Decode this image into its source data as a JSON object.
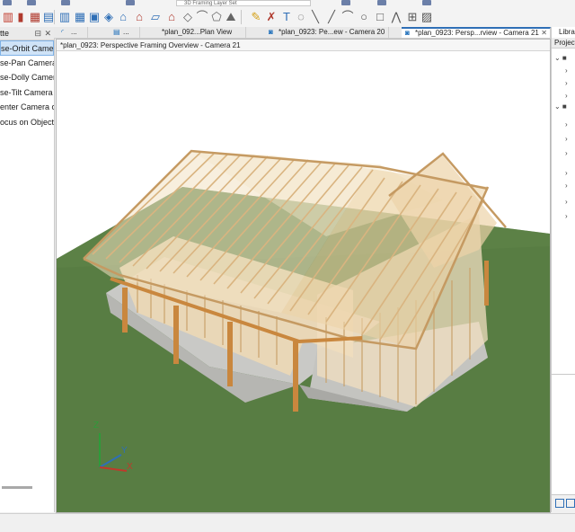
{
  "toolbar": {
    "layer_set_label": "3D Framing Layer Set"
  },
  "palette": {
    "title": "tte",
    "items": [
      "se-Orbit Camera",
      "se-Pan Camera",
      "se-Dolly Camera",
      "se-Tilt Camera",
      "enter Camera on",
      "ocus on Object"
    ],
    "selected_index": 0
  },
  "tabs": [
    {
      "label": "..."
    },
    {
      "label": "..."
    },
    {
      "label": "*plan_092...Plan View"
    },
    {
      "label": "*plan_0923: Pe...ew - Camera 20"
    },
    {
      "label": "*plan_0923: Persp...rview - Camera 21"
    }
  ],
  "view": {
    "title": "*plan_0923: Perspective Framing Overview - Camera 21",
    "axes": {
      "z": "Z",
      "y": "Y",
      "x": "X"
    }
  },
  "right_panel": {
    "tab_library": "Libra",
    "header": "Project"
  },
  "colors": {
    "ground": "#587d43",
    "lumber": "#e8c79a",
    "lumber_dark": "#c59a62",
    "concrete": "#c9c9c6",
    "accent": "#2f6fb6"
  }
}
